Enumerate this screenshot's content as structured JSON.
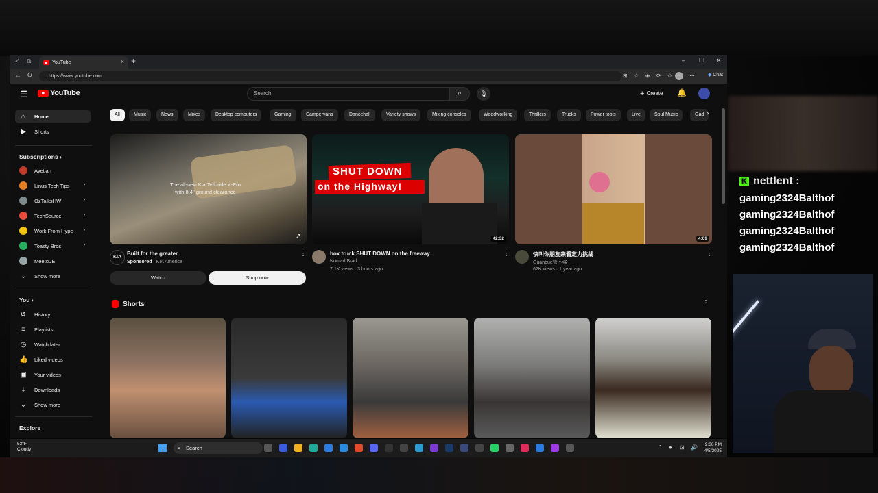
{
  "browser": {
    "tab_title": "YouTube",
    "url": "https://www.youtube.com",
    "chat_label": "Chat"
  },
  "header": {
    "logo_text": "YouTube",
    "search_placeholder": "Search",
    "create_label": "Create"
  },
  "sidebar": {
    "main": [
      {
        "label": "Home",
        "icon": "home-icon",
        "active": true
      },
      {
        "label": "Shorts",
        "icon": "shorts-icon",
        "active": false
      }
    ],
    "subscriptions_heading": "Subscriptions",
    "subscriptions": [
      {
        "label": "Ayetian",
        "color": "#c0392b"
      },
      {
        "label": "Linus Tech Tips",
        "color": "#e67e22"
      },
      {
        "label": "OzTalksHW",
        "color": "#7f8c8d"
      },
      {
        "label": "TechSource",
        "color": "#e74c3c"
      },
      {
        "label": "Work From Hype",
        "color": "#f1c40f"
      },
      {
        "label": "Toasty Bros",
        "color": "#27ae60"
      },
      {
        "label": "MeelxDE",
        "color": "#95a5a6"
      }
    ],
    "show_more": "Show more",
    "you_heading": "You",
    "you_items": [
      {
        "label": "History",
        "icon": "history-icon"
      },
      {
        "label": "Playlists",
        "icon": "playlists-icon"
      },
      {
        "label": "Watch later",
        "icon": "watch-later-icon"
      },
      {
        "label": "Liked videos",
        "icon": "liked-icon"
      },
      {
        "label": "Your videos",
        "icon": "your-videos-icon"
      },
      {
        "label": "Downloads",
        "icon": "download-icon"
      }
    ],
    "show_more_2": "Show more",
    "explore_heading": "Explore"
  },
  "chips": [
    "All",
    "Music",
    "News",
    "Mixes",
    "Desktop computers",
    "Gaming",
    "Campervans",
    "Dancehall",
    "Variety shows",
    "Mixing consoles",
    "Woodworking",
    "Thrillers",
    "Trucks",
    "Power tools",
    "Live",
    "Soul Music",
    "Gad"
  ],
  "ad": {
    "title": "Built for the greater",
    "sponsored": "Sponsored",
    "advertiser": "· KIA America",
    "overlay_line1": "The all-new Kia Telluride X-Pro",
    "overlay_line2": "with 8.4\" ground clearance",
    "watch_label": "Watch",
    "shop_label": "Shop now"
  },
  "videos": [
    {
      "title": "box truck SHUT DOWN on the freeway",
      "channel": "Nomad Brad",
      "meta": "7.1K views · 3 hours ago",
      "duration": "42:32",
      "thumb_text1": "SHUT DOWN",
      "thumb_text2": "on the Highway!"
    },
    {
      "title": "快叫你朋友来看定力挑战",
      "channel": "Guanbue管不強",
      "meta": "62K views · 1 year ago",
      "duration": "4:09"
    }
  ],
  "shorts_heading": "Shorts",
  "taskbar": {
    "temp": "53°F",
    "condition": "Cloudy",
    "search_label": "Search",
    "time": "9:36 PM",
    "date": "4/5/2025"
  },
  "stream_chat": {
    "username": "nettlent :",
    "lines": [
      "gaming2324Balthof",
      "gaming2324Balthof",
      "gaming2324Balthof",
      "gaming2324Balthof"
    ]
  }
}
